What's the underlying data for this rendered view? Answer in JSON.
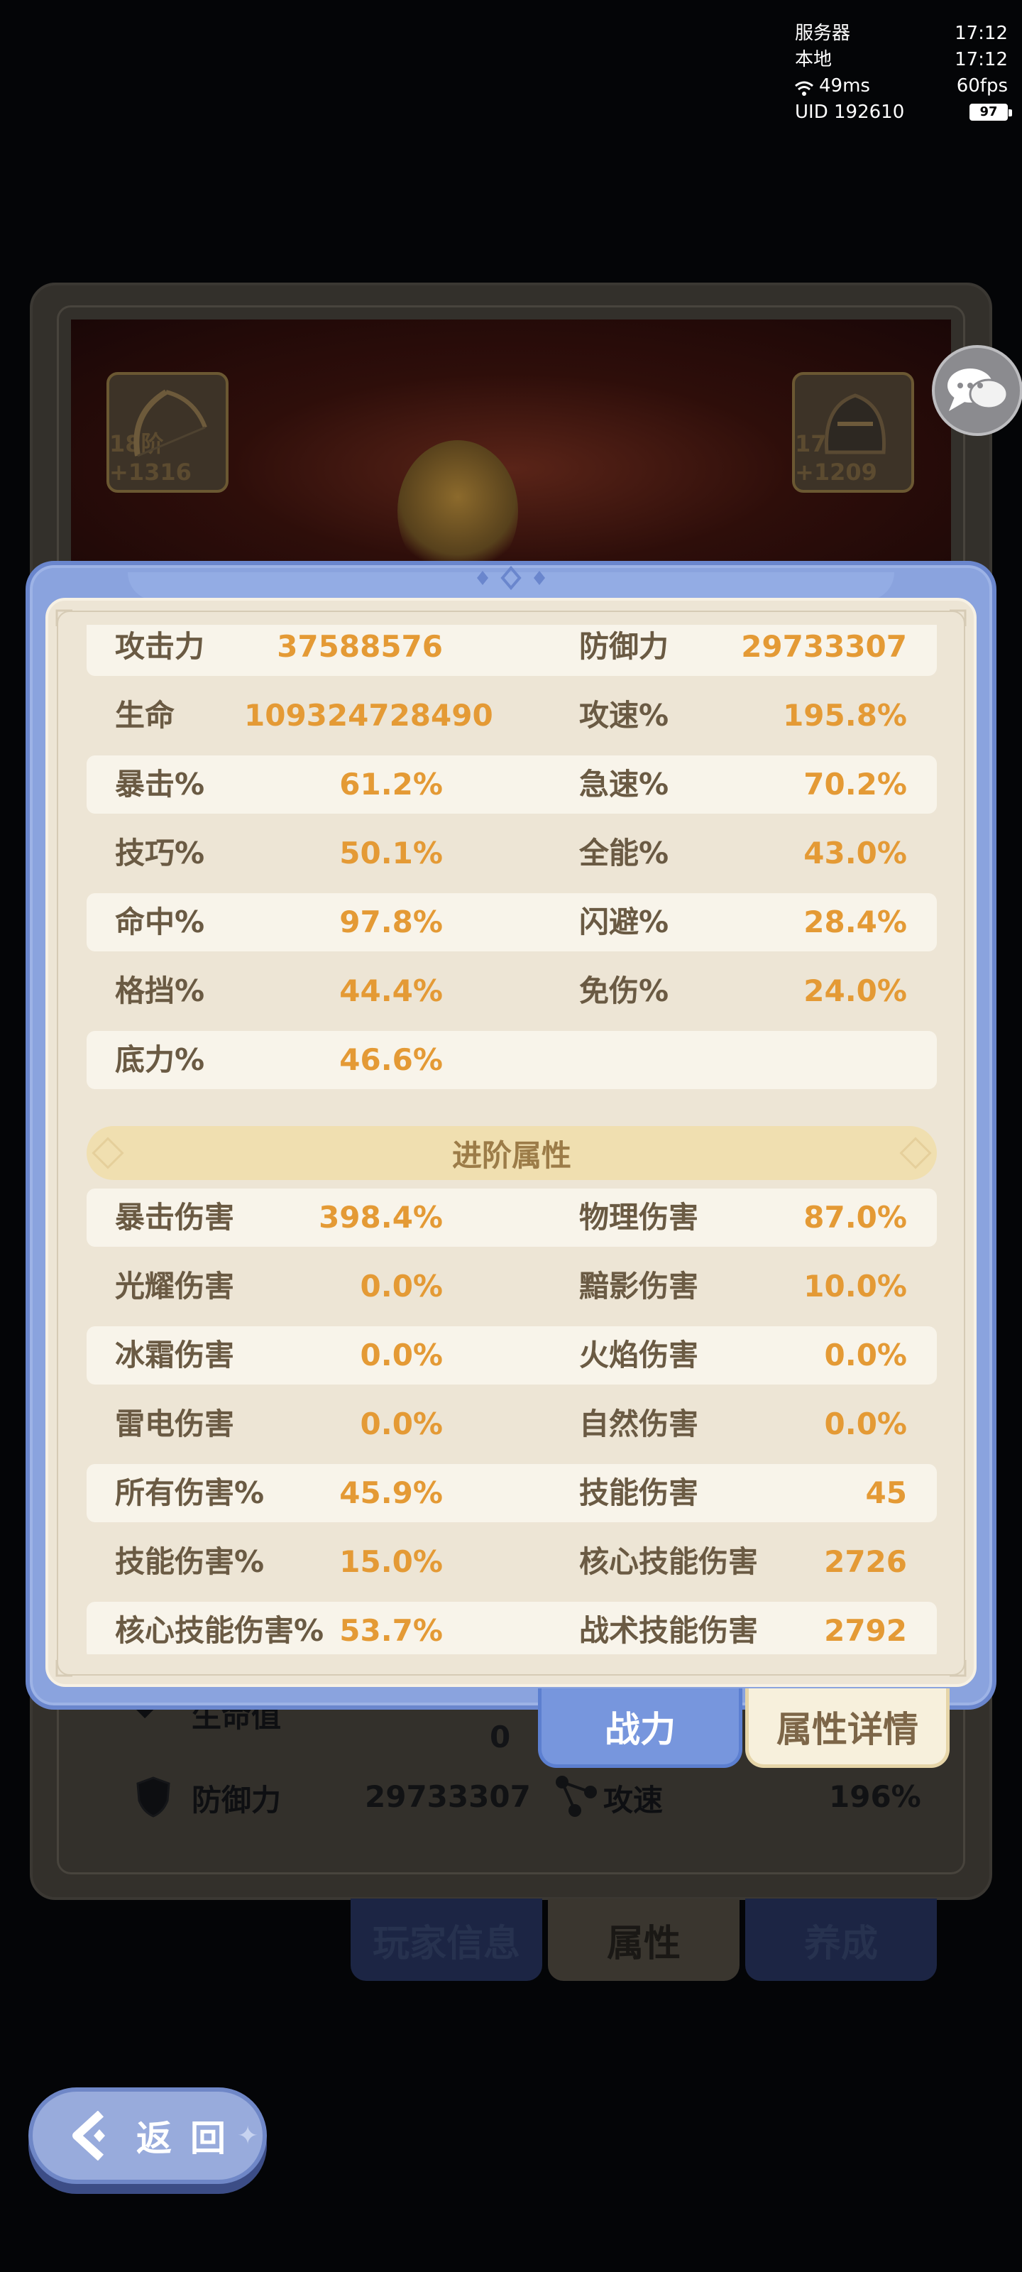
{
  "hud": {
    "server_label": "服务器",
    "server_time": "17:12",
    "local_label": "本地",
    "local_time": "17:12",
    "ping": "49ms",
    "fps": "60fps",
    "uid": "UID 192610",
    "battery": "97"
  },
  "equipment": {
    "left_level": "18阶+1316",
    "right_level": "17阶+1209"
  },
  "background_stats": {
    "hp_label": "生命值",
    "hp_value": "0",
    "def_label": "防御力",
    "def_value": "29733307",
    "atk_speed_label": "攻速",
    "atk_speed_value": "196%"
  },
  "basic_attributes": [
    {
      "left_label": "攻击力",
      "left_value": "37588576",
      "right_label": "防御力",
      "right_value": "29733307"
    },
    {
      "left_label": "生命",
      "left_value": "109324728490",
      "right_label": "攻速%",
      "right_value": "195.8%"
    },
    {
      "left_label": "暴击%",
      "left_value": "61.2%",
      "right_label": "急速%",
      "right_value": "70.2%"
    },
    {
      "left_label": "技巧%",
      "left_value": "50.1%",
      "right_label": "全能%",
      "right_value": "43.0%"
    },
    {
      "left_label": "命中%",
      "left_value": "97.8%",
      "right_label": "闪避%",
      "right_value": "28.4%"
    },
    {
      "left_label": "格挡%",
      "left_value": "44.4%",
      "right_label": "免伤%",
      "right_value": "24.0%"
    },
    {
      "left_label": "底力%",
      "left_value": "46.6%",
      "right_label": "",
      "right_value": ""
    }
  ],
  "advanced_section_title": "进阶属性",
  "advanced_attributes": [
    {
      "left_label": "暴击伤害",
      "left_value": "398.4%",
      "right_label": "物理伤害",
      "right_value": "87.0%"
    },
    {
      "left_label": "光耀伤害",
      "left_value": "0.0%",
      "right_label": "黯影伤害",
      "right_value": "10.0%"
    },
    {
      "left_label": "冰霜伤害",
      "left_value": "0.0%",
      "right_label": "火焰伤害",
      "right_value": "0.0%"
    },
    {
      "left_label": "雷电伤害",
      "left_value": "0.0%",
      "right_label": "自然伤害",
      "right_value": "0.0%"
    },
    {
      "left_label": "所有伤害%",
      "left_value": "45.9%",
      "right_label": "技能伤害",
      "right_value": "45"
    },
    {
      "left_label": "技能伤害%",
      "left_value": "15.0%",
      "right_label": "核心技能伤害",
      "right_value": "2726"
    },
    {
      "left_label": "核心技能伤害%",
      "left_value": "53.7%",
      "right_label": "战术技能伤害",
      "right_value": "2792"
    }
  ],
  "panel_tabs": {
    "power": "战力",
    "detail": "属性详情"
  },
  "nav_tabs": {
    "player_info": "玩家信息",
    "attributes": "属性",
    "training": "养成"
  },
  "back_button": "返回",
  "colors": {
    "panel_blue": "#8aa3de",
    "paper": "#ede5d5",
    "value_orange": "#e49a35",
    "label_brown": "#6a5a43"
  }
}
